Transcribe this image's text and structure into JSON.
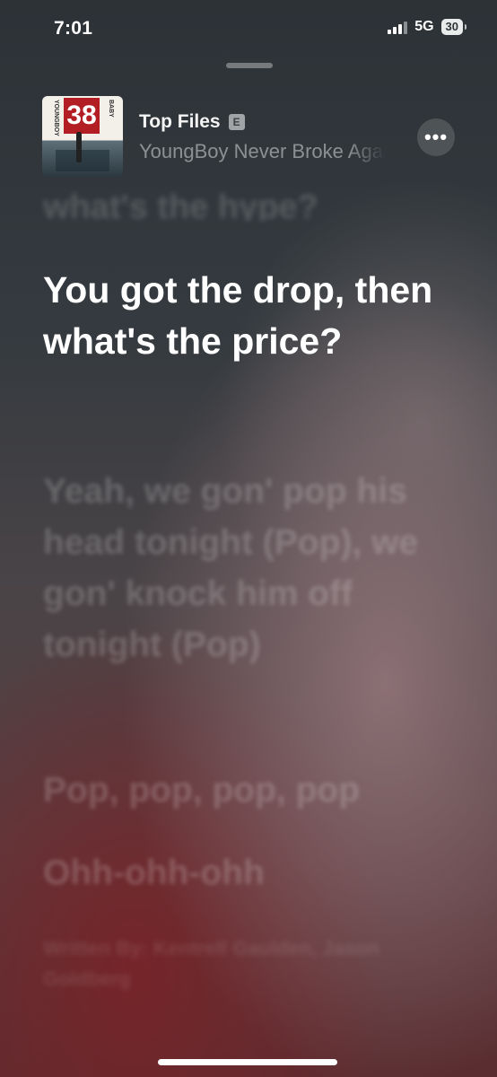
{
  "status_bar": {
    "time": "7:01",
    "network": "5G",
    "battery": "30"
  },
  "now_playing": {
    "artwork_text": "38",
    "artwork_side_left": "YOUNGBOY",
    "artwork_side_right": "BABY",
    "title": "Top Files",
    "explicit_label": "E",
    "artist": "YoungBoy Never Broke Again",
    "more_label": "•••"
  },
  "lyrics": {
    "previous": "what's the hype?",
    "current": "You got the drop, then what's the price?",
    "upcoming": [
      "Yeah, we gon' pop his head tonight (Pop), we gon' knock him off tonight (Pop)",
      "Pop, pop, pop, pop",
      "Ohh-ohh-ohh"
    ],
    "credits": "Written By: Kentrell Gaulden, Jason Goldberg"
  },
  "colors": {
    "background_top": "#2c3236",
    "background_bottom": "#5a2d30",
    "lyric_active": "#ffffff"
  }
}
